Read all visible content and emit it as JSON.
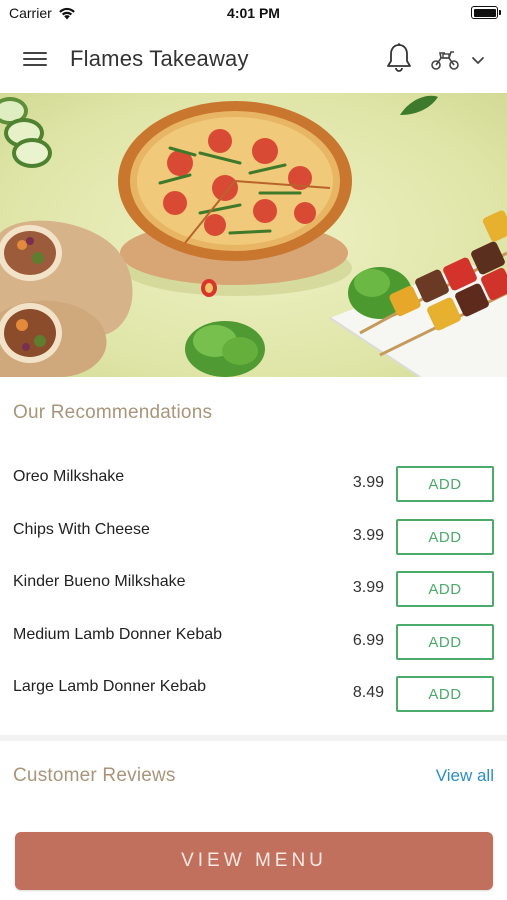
{
  "status_bar": {
    "carrier": "Carrier",
    "time": "4:01 PM",
    "battery_level": 1.0
  },
  "header": {
    "title": "Flames Takeaway",
    "icons": [
      "menu-icon",
      "bell-icon",
      "scooter-icon",
      "chevron-down-icon"
    ]
  },
  "banner": {
    "image_subject": "pizza, wraps, kebab skewers, cucumber and lettuce on green background"
  },
  "recommendations": {
    "title": "Our Recommendations",
    "items": [
      {
        "name": "Oreo Milkshake",
        "price": "3.99",
        "button": "ADD"
      },
      {
        "name": "Chips With Cheese",
        "price": "3.99",
        "button": "ADD"
      },
      {
        "name": "Kinder Bueno Milkshake",
        "price": "3.99",
        "button": "ADD"
      },
      {
        "name": "Medium Lamb Donner Kebab",
        "price": "6.99",
        "button": "ADD"
      },
      {
        "name": "Large Lamb Donner Kebab",
        "price": "8.49",
        "button": "ADD"
      }
    ]
  },
  "reviews": {
    "title": "Customer Reviews",
    "view_all": "View all"
  },
  "footer": {
    "view_menu": "VIEW MENU"
  },
  "colors": {
    "accent_green": "#4caa6a",
    "section_title": "#a8957a",
    "link_blue": "#2c8fc3",
    "view_menu_bg": "#c0705c"
  }
}
